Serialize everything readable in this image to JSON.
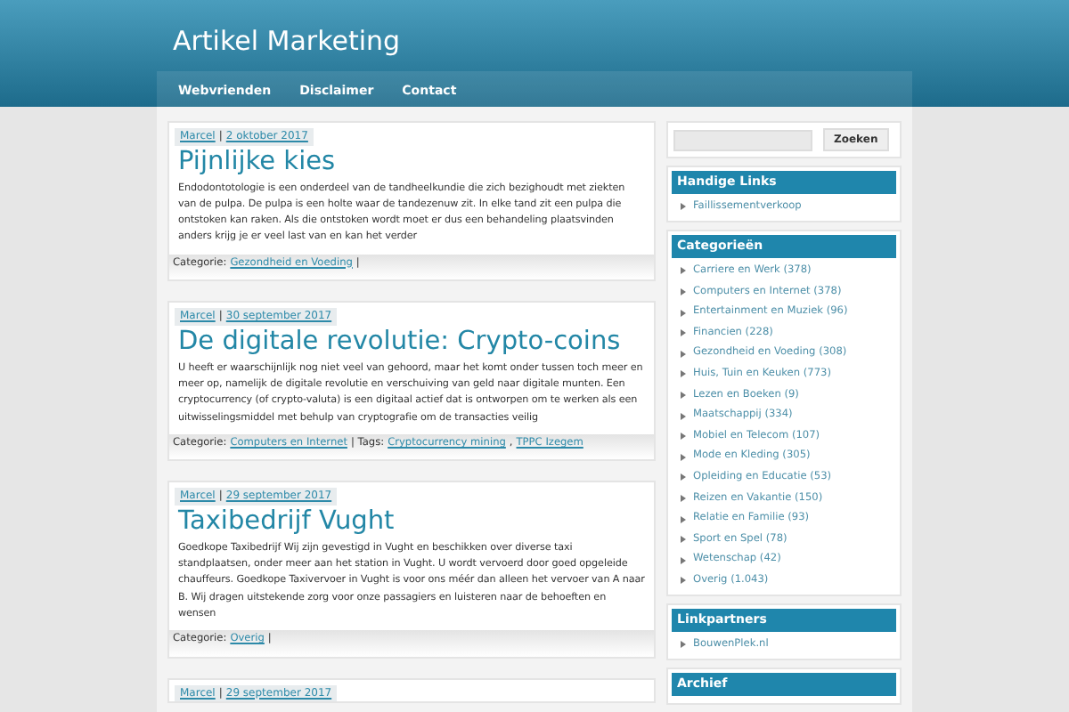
{
  "site": {
    "title": "Artikel Marketing"
  },
  "nav": [
    {
      "label": "Webvrienden"
    },
    {
      "label": "Disclaimer"
    },
    {
      "label": "Contact"
    }
  ],
  "posts": [
    {
      "meta": [
        {
          "kind": "link",
          "text": "Marcel"
        },
        {
          "kind": "label",
          "text": "|"
        },
        {
          "kind": "link",
          "text": "2 oktober 2017"
        }
      ],
      "title": "Pijnlijke kies",
      "excerpt": "Endodontotologie is een onderdeel van de tandheelkundie die zich bezighoudt met ziekten van de pulpa. De pulpa is een holte waar de tandezenuw zit. In elke tand zit een pulpa die ontstoken kan raken. Als die ontstoken wordt moet er dus een behandeling plaatsvinden anders krijg je er veel last van en kan het verder",
      "footer": [
        {
          "kind": "label",
          "text": "Categorie:"
        },
        {
          "kind": "link",
          "text": "Gezondheid en Voeding"
        },
        {
          "kind": "label",
          "text": "|"
        }
      ]
    },
    {
      "meta": [
        {
          "kind": "link",
          "text": "Marcel"
        },
        {
          "kind": "label",
          "text": "|"
        },
        {
          "kind": "link",
          "text": "30 september 2017"
        }
      ],
      "title": "De digitale revolutie: Crypto-coins",
      "excerpt": "U heeft er waarschijnlijk nog niet veel van gehoord, maar het komt onder tussen toch meer en meer op, namelijk de digitale revolutie en verschuiving van geld naar digitale munten. Een cryptocurrency (of crypto-valuta) is een digitaal actief dat is ontworpen om te werken als een uitwisselingsmiddel met behulp van cryptografie om de transacties veilig",
      "footer": [
        {
          "kind": "label",
          "text": "Categorie:"
        },
        {
          "kind": "link",
          "text": "Computers en Internet"
        },
        {
          "kind": "label",
          "text": "| Tags:"
        },
        {
          "kind": "link",
          "text": "Cryptocurrency mining"
        },
        {
          "kind": "label",
          "text": ","
        },
        {
          "kind": "link",
          "text": "TPPC Izegem"
        }
      ]
    },
    {
      "meta": [
        {
          "kind": "link",
          "text": "Marcel"
        },
        {
          "kind": "label",
          "text": "|"
        },
        {
          "kind": "link",
          "text": "29 september 2017"
        }
      ],
      "title": "Taxibedrijf Vught",
      "excerpt": "Goedkope Taxibedrijf Wij zijn gevestigd in Vught en beschikken over diverse taxi standplaatsen, onder meer aan het station in Vught. U wordt vervoerd door goed opgeleide chauffeurs. Goedkope Taxivervoer in Vught is voor ons méér dan alleen het vervoer van A naar B. Wij dragen uitstekende zorg voor onze passagiers en luisteren naar de behoeften en wensen",
      "footer": [
        {
          "kind": "label",
          "text": "Categorie:"
        },
        {
          "kind": "link",
          "text": "Overig"
        },
        {
          "kind": "label",
          "text": "|"
        }
      ]
    },
    {
      "meta": [
        {
          "kind": "link",
          "text": "Marcel"
        },
        {
          "kind": "label",
          "text": "|"
        },
        {
          "kind": "link",
          "text": "29 september 2017"
        }
      ]
    }
  ],
  "search": {
    "button": "Zoeken"
  },
  "widgets": [
    {
      "title": "Handige Links",
      "items": [
        "Faillissementverkoop"
      ]
    },
    {
      "title": "Categorieën",
      "items": [
        "Carriere en Werk (378)",
        "Computers en Internet (378)",
        "Entertainment en Muziek (96)",
        "Financien (228)",
        "Gezondheid en Voeding (308)",
        "Huis, Tuin en Keuken (773)",
        "Lezen en Boeken (9)",
        "Maatschappij (334)",
        "Mobiel en Telecom (107)",
        "Mode en Kleding (305)",
        "Opleiding en Educatie (53)",
        "Reizen en Vakantie (150)",
        "Relatie en Familie (93)",
        "Sport en Spel (78)",
        "Wetenschap (42)",
        "Overig (1.043)"
      ]
    },
    {
      "title": "Linkpartners",
      "items": [
        "BouwenPlek.nl"
      ]
    },
    {
      "title": "Archief"
    }
  ]
}
